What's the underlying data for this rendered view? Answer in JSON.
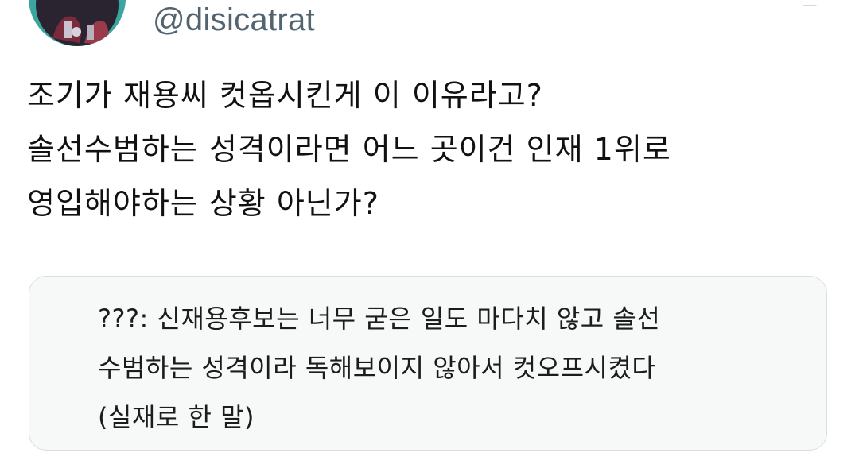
{
  "author": {
    "handle": "@disicatrat",
    "avatar_icon": "profile-avatar-icon"
  },
  "tweet": {
    "lines": [
      "조기가 재용씨 컷옵시킨게 이 이유라고?",
      "솔선수범하는 성격이라면 어느 곳이건 인재 1위로",
      "영입해야하는 상황 아닌가?"
    ]
  },
  "quote": {
    "lines": [
      "???: 신재용후보는 너무 굳은 일도 마다치 않고 솔선",
      "수범하는 성격이라 독해보이지 않아서 컷오프시켰다",
      "(실재로 한 말)"
    ]
  },
  "colors": {
    "handle": "#536471",
    "text": "#111111",
    "quote_background": "#f7f8f8",
    "quote_border": "#d9dee3",
    "avatar_background": "#3aa6a0"
  }
}
